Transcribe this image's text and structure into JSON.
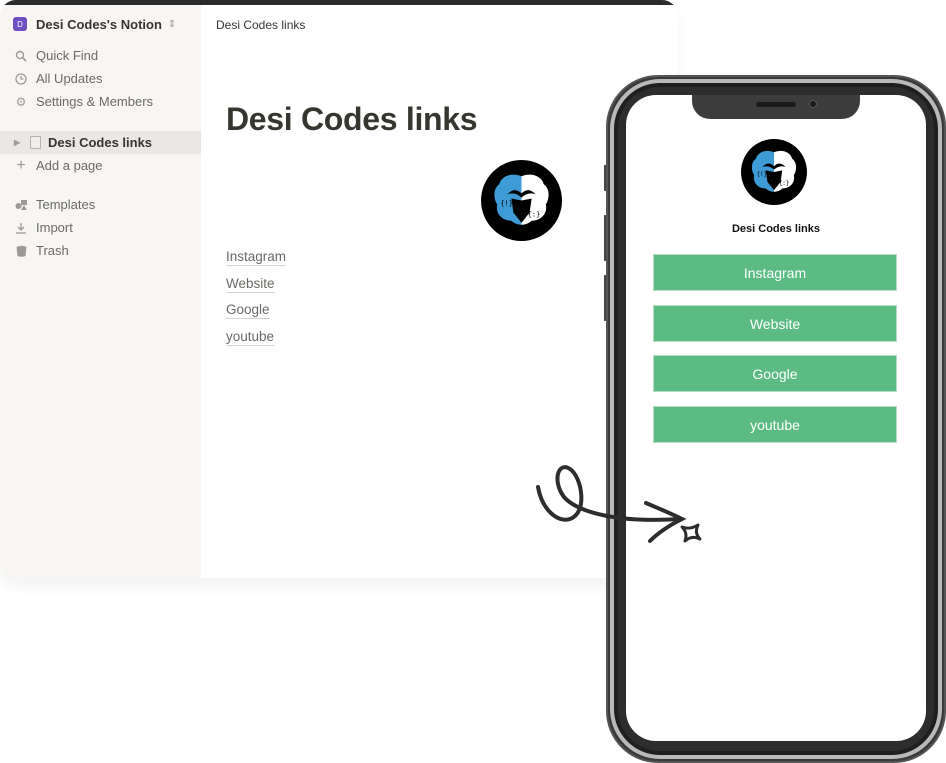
{
  "sidebar": {
    "workspace_initial": "D",
    "workspace_name": "Desi Codes's Notion",
    "workspace_color": "#6f4fc2",
    "nav": [
      {
        "icon": "search-icon",
        "label": "Quick Find"
      },
      {
        "icon": "clock-icon",
        "label": "All Updates"
      },
      {
        "icon": "gear-icon",
        "label": "Settings & Members"
      }
    ],
    "pages": [
      {
        "icon": "page-icon",
        "label": "Desi Codes links"
      }
    ],
    "add_page_label": "Add a page",
    "footer": [
      {
        "icon": "templates-icon",
        "label": "Templates"
      },
      {
        "icon": "import-icon",
        "label": "Import"
      },
      {
        "icon": "trash-icon",
        "label": "Trash"
      }
    ]
  },
  "main": {
    "breadcrumb": "Desi Codes links",
    "title": "Desi Codes links",
    "links": [
      "Instagram",
      "Website",
      "Google",
      "youtube"
    ]
  },
  "phone": {
    "title": "Desi Codes links",
    "button_color": "#5cbb83",
    "buttons": [
      "Instagram",
      "Website",
      "Google",
      "youtube"
    ]
  }
}
